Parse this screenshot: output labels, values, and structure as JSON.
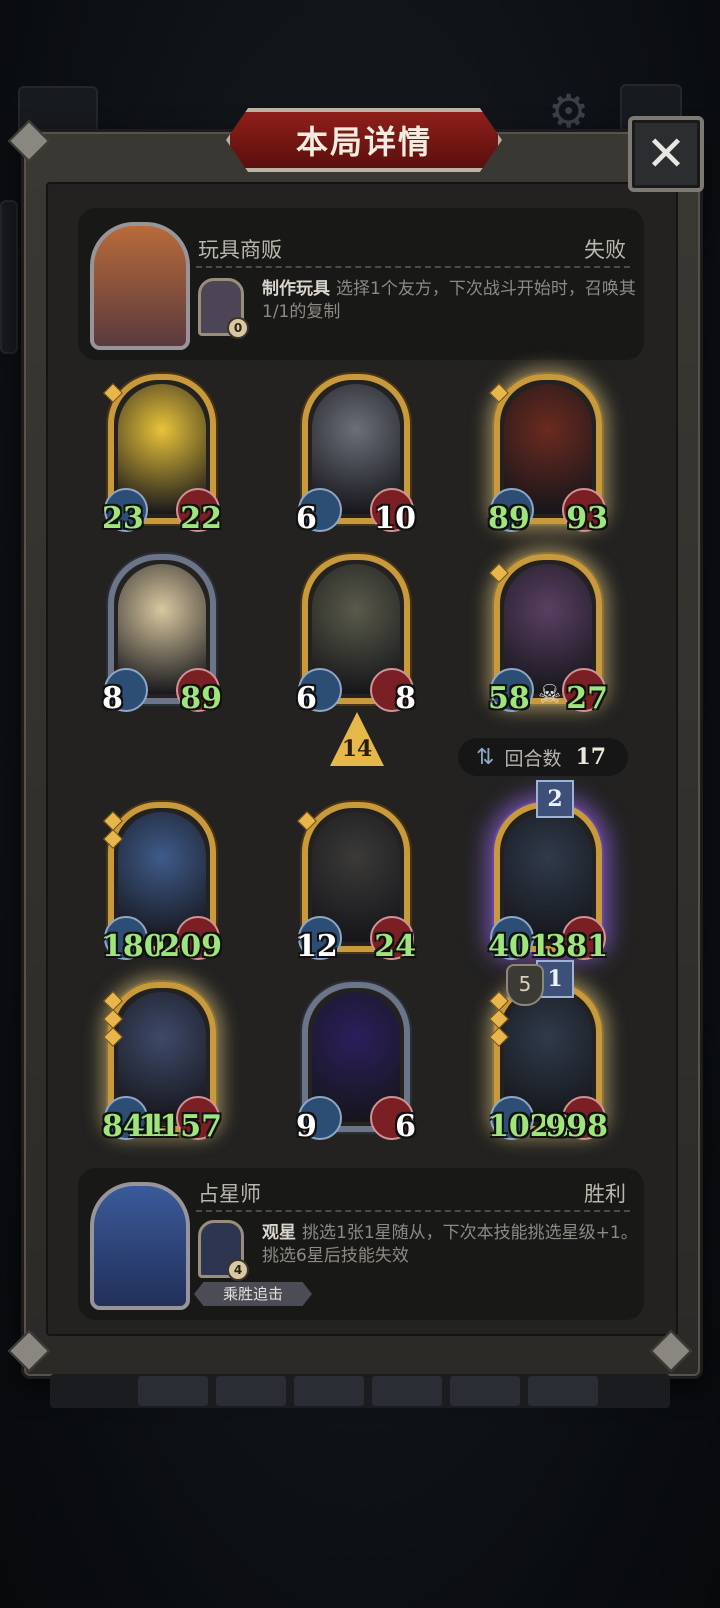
{
  "title": "本局详情",
  "close_label": "✕",
  "opponent": {
    "hero_name": "玩具商贩",
    "result": "失败",
    "skill_name": "制作玩具",
    "skill_desc": "选择1个友方，下次战斗开始时，召唤其1/1的复制",
    "skill_cost": "0"
  },
  "opponent_board": [
    {
      "attack": "23",
      "health": "22",
      "stars": 1,
      "art_color": "#e9c33a",
      "silver": false,
      "glow": false
    },
    {
      "attack": "6",
      "health": "10",
      "stars": 0,
      "art_color": "#6b6f79",
      "silver": false,
      "glow": false
    },
    {
      "attack": "89",
      "health": "93",
      "stars": 1,
      "art_color": "#6b2a1f",
      "silver": false,
      "glow": true
    },
    {
      "attack": "8",
      "health": "89",
      "stars": 0,
      "art_color": "#d9c8a0",
      "silver": true,
      "glow": false
    },
    {
      "attack": "6",
      "health": "8",
      "stars": 0,
      "art_color": "#5a5b4a",
      "silver": false,
      "glow": false
    },
    {
      "attack": "58",
      "health": "27",
      "stars": 1,
      "art_color": "#5a3f63",
      "silver": false,
      "glow": true
    }
  ],
  "level": "14",
  "round": {
    "label": "回合数",
    "value": "17"
  },
  "player_board": [
    {
      "attack": "180",
      "health": "209",
      "stars": 2,
      "art_color": "#3f5b8a",
      "silver": false,
      "glow": false
    },
    {
      "attack": "12",
      "health": "24",
      "stars": 1,
      "art_color": "#3b3a38",
      "silver": false,
      "glow": false
    },
    {
      "attack": "401",
      "health": "381",
      "stars": 0,
      "art_color": "#2f3a4a",
      "silver": false,
      "glow": "purple",
      "rank": "2"
    },
    {
      "attack": "844",
      "health": "1157",
      "stars": 3,
      "art_color": "#3e4a6a",
      "silver": false,
      "glow": true
    },
    {
      "attack": "9",
      "health": "6",
      "stars": 0,
      "art_color": "#2b1f5c",
      "silver": true,
      "glow": false
    },
    {
      "attack": "1020",
      "health": "998",
      "stars": 3,
      "art_color": "#2f3a4a",
      "silver": false,
      "glow": true,
      "rank": "1",
      "shield": "5"
    }
  ],
  "player": {
    "hero_name": "占星师",
    "result": "胜利",
    "skill_name": "观星",
    "skill_desc": "挑选1张1星随从，下次本技能挑选星级+1。挑选6星后技能失效",
    "skill_cost": "4",
    "streak_label": "乘胜追击"
  }
}
